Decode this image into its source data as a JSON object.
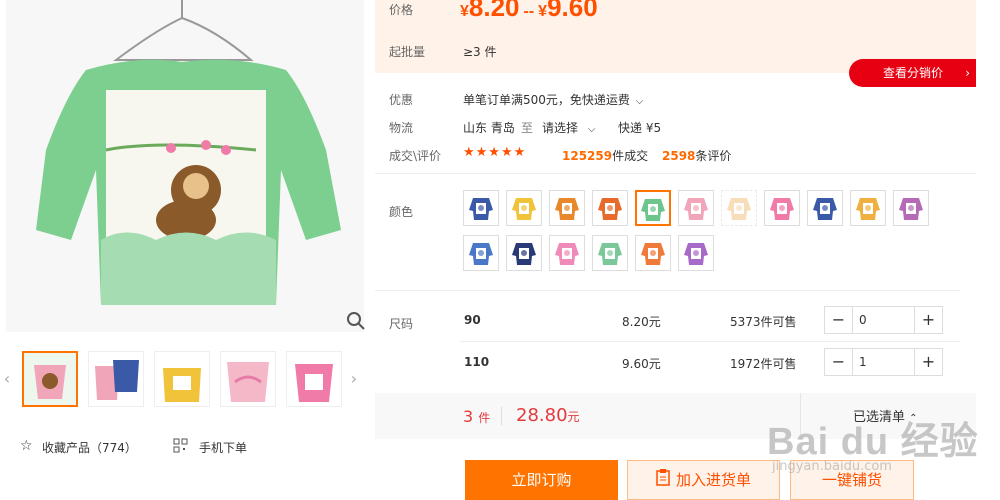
{
  "price_section": {
    "price_label": "价格",
    "currency": "¥",
    "price_low": "8.20",
    "separator": "--",
    "price_high": "9.60",
    "moq_label": "起批量",
    "moq_value": "≥3 件"
  },
  "distribution_button": "查看分销价",
  "offers": {
    "promo_label": "优惠",
    "promo_text": "单笔订单满500元，免快递运费",
    "logistics_label": "物流",
    "from_location": "山东 青岛",
    "to_word": "至",
    "select_destination": "请选择",
    "shipping_method": "快递 ¥5",
    "deals_label": "成交\\评价",
    "stars": "★★★★★",
    "deals_count": "125259",
    "deals_unit": "件成交",
    "reviews_count": "2598",
    "reviews_unit": "条评价"
  },
  "color_label": "颜色",
  "swatch_colors": [
    "#3a5aa8",
    "#f0c33a",
    "#e8882a",
    "#e86a2a",
    "#6cc58a",
    "#f0a6b8",
    "#f5c98a",
    "#f07aa8",
    "#3a5aa8",
    "#f0b040",
    "#b56ab8",
    "#4a78c8",
    "#2a3a78",
    "#f08ab8",
    "#7ac89a",
    "#f07a3a",
    "#a86ac8"
  ],
  "size_label": "尺码",
  "sizes": [
    {
      "name": "90",
      "price": "8.20元",
      "stock": "5373件可售",
      "qty": "0"
    },
    {
      "name": "110",
      "price": "9.60元",
      "stock": "1972件可售",
      "qty": "1"
    }
  ],
  "summary": {
    "quantity": "3",
    "quantity_unit": "件",
    "total": "28.80",
    "total_unit": "元",
    "selected_list": "已选清单"
  },
  "actions": {
    "buy_now": "立即订购",
    "add_to_cart": "加入进货单",
    "quick_stock": "一键铺货"
  },
  "left_panel": {
    "favorite_label": "收藏产品（774）",
    "mobile_order": "手机下单"
  },
  "watermark": {
    "brand": "Bai du 经验",
    "url": "jingyan.baidu.com"
  }
}
